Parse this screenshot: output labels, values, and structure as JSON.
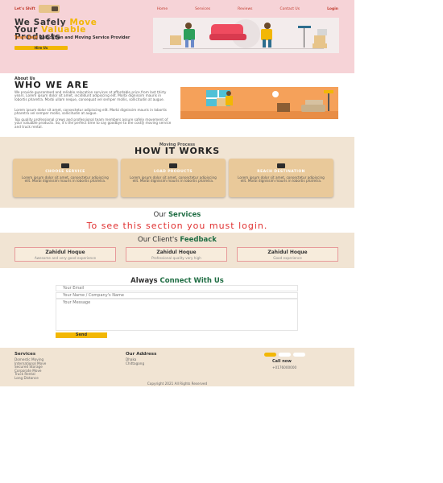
{
  "nav": {
    "logo": "Let's Shift",
    "links": [
      "Home",
      "Services",
      "Reviews",
      "Contact Us"
    ],
    "login": "Login"
  },
  "hero": {
    "title_part1": "We Safely ",
    "title_hl1": "Move",
    "title_part2": " Your ",
    "title_hl2": "Valuable",
    "title_part3": " Products",
    "tag_hl": "Team Best",
    "tag_rest": " Relocation and Moving Service Provider",
    "cta": "Hire Us"
  },
  "about": {
    "label": "About Us",
    "title": "WHO WE ARE",
    "p1": "We provide guaranteed and reliable relocation services at affordable price from last thirty years. Lorem ipsum dolor sit amet, incididunt adipiscing elit. Morbi dignissim mauris in lobortis pharetra. Morbi ullam neque, consequat vel semper mollis, sollicitudin at augue.",
    "p2": "Lorem ipsum dolor sit amet, consectetur adipiscing elit. Morbi dignissim mauris in lobortis pharetra vel semper mollis, sollicitudin at augue.",
    "p3": "Top quality professional crews and professional team members assure safely movement of your valuable products. So, it's the perfect time to say goodbye to the costly moving service and truck rental."
  },
  "works": {
    "label": "Moving Process",
    "title": "HOW IT WORKS",
    "cards": [
      {
        "title": "CHOOSE SERVICE",
        "text": "Lorem ipsum dolor sit amet, consectetur adipiscing elit. Morbi dignissim mauris in lobortis pharetra."
      },
      {
        "title": "LOAD PRODUCTS",
        "text": "Lorem ipsum dolor sit amet, consectetur adipiscing elit. Morbi dignissim mauris in lobortis pharetra."
      },
      {
        "title": "REACH DESTINATION",
        "text": "Lorem ipsum dolor sit amet, consectetur adipiscing elit. Morbi dignissim mauris in lobortis pharetra."
      }
    ]
  },
  "services": {
    "title_prefix": "Our ",
    "title_hl": "Services",
    "login_notice": "To see this section you must login."
  },
  "feedback": {
    "title_prefix": "Our Client's ",
    "title_hl": "Feedback",
    "cards": [
      {
        "name": "Zahidul Hoque",
        "text": "Awesome and very good experience"
      },
      {
        "name": "Zahidul Hoque",
        "text": "Professional quality very high"
      },
      {
        "name": "Zahidul Hoque",
        "text": "Good experience"
      }
    ]
  },
  "contact": {
    "title_prefix": "Always ",
    "title_hl": "Connect With Us",
    "email_placeholder": "Your Email",
    "name_placeholder": "Your Name / Company's Name",
    "message_placeholder": "Your Message",
    "send": "Send"
  },
  "footer": {
    "services_head": "Services",
    "services": [
      "Domestic Moving",
      "International Move",
      "Secured Storage",
      "Corporate Move",
      "Truck Rental",
      "Long Distance"
    ],
    "address_head": "Our Address",
    "address": [
      "Dhaka",
      "Chittagong"
    ],
    "call_head": "Call now",
    "phone": "+0176000000",
    "copyright": "Copyright 2021 All Rights Reserved"
  }
}
